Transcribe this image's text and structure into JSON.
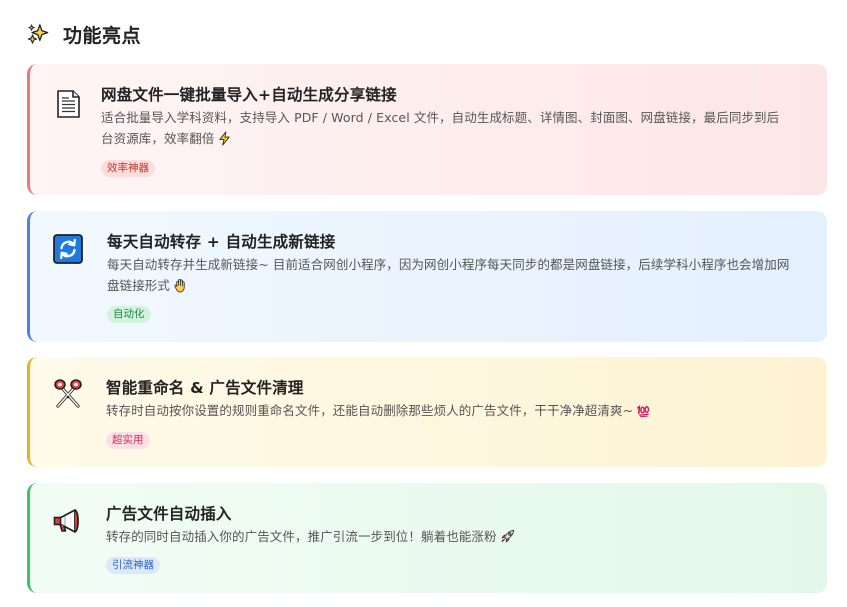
{
  "section": {
    "title": "功能亮点",
    "icon": "sparkles-icon"
  },
  "cards": [
    {
      "icon": "document-icon",
      "title": "网盘文件一键批量导入+自动生成分享链接",
      "description": "适合批量导入学科资料，支持导入 PDF / Word / Excel 文件，自动生成标题、详情图、封面图、网盘链接，最后同步到后台资源库，效率翻倍",
      "emoji": "lightning-icon",
      "tag": "效率神器",
      "accent": "#ee7777"
    },
    {
      "icon": "refresh-icon",
      "title": "每天自动转存 + 自动生成新链接",
      "description": "每天自动转存并生成新链接~ 目前适合网创小程序，因为网创小程序每天同步的都是网盘链接，后续学科小程序也会增加网盘链接形式",
      "emoji": "hand-icon",
      "tag": "自动化",
      "accent": "#4a86e0"
    },
    {
      "icon": "scissors-icon",
      "title": "智能重命名 & 广告文件清理",
      "description": "转存时自动按你设置的规则重命名文件，还能自动删除那些烦人的广告文件，干干净净超清爽~",
      "emoji": "hundred-points-icon",
      "tag": "超实用",
      "accent": "#e8b21e"
    },
    {
      "icon": "megaphone-icon",
      "title": "广告文件自动插入",
      "description": "转存的同时自动插入你的广告文件，推广引流一步到位！躺着也能涨粉",
      "emoji": "rocket-icon",
      "tag": "引流神器",
      "accent": "#3dc46a"
    }
  ]
}
